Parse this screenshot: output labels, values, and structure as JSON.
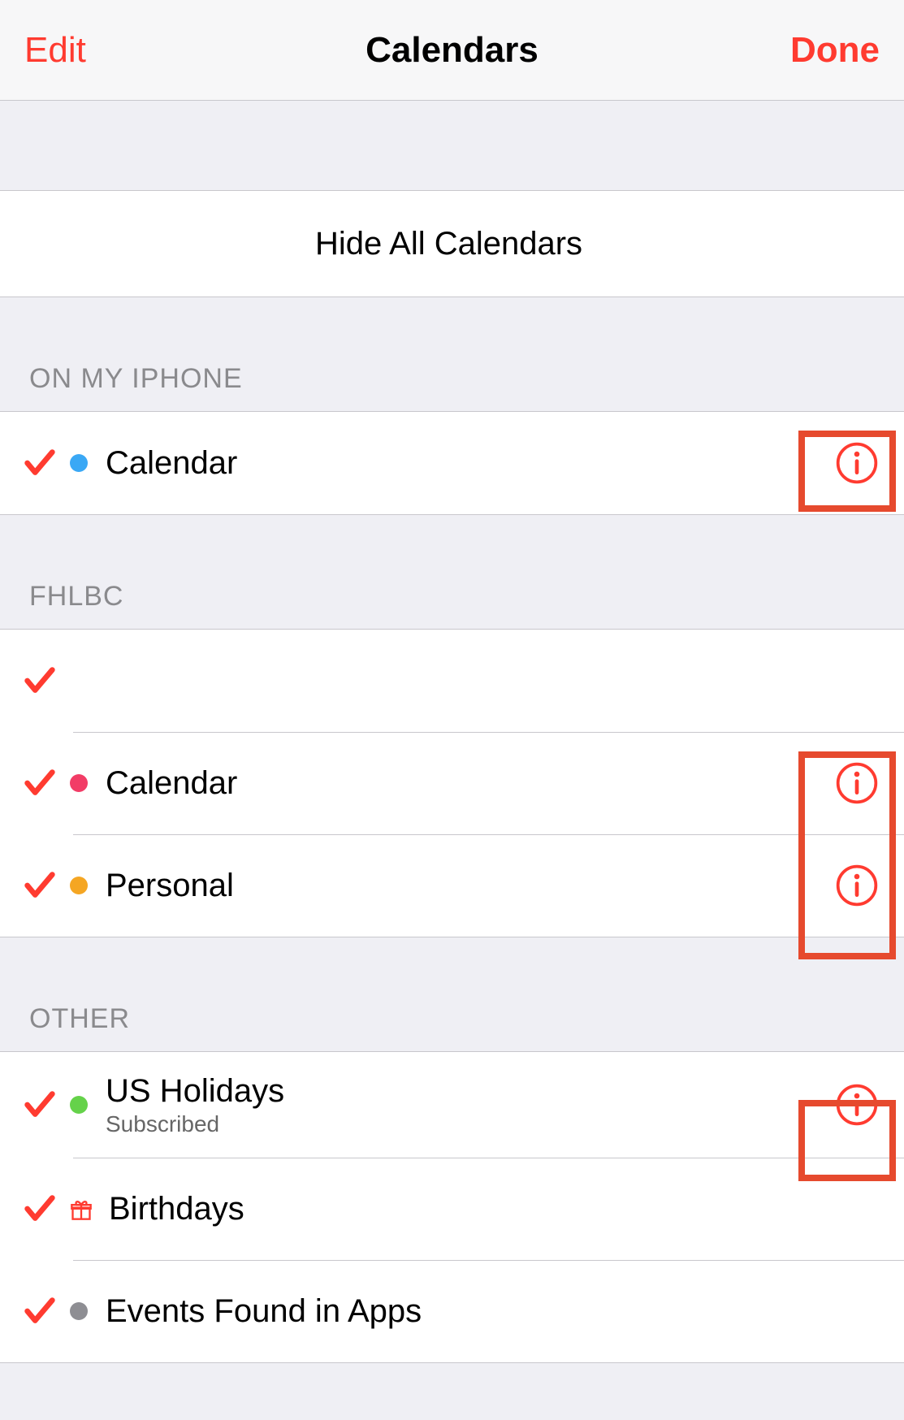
{
  "navbar": {
    "left": "Edit",
    "title": "Calendars",
    "right": "Done"
  },
  "hide_all_label": "Hide All Calendars",
  "colors": {
    "accent": "#ff3b30",
    "gray_text": "#8a8a8d",
    "blue_dot": "#3aa8f5",
    "pink_dot": "#f23c66",
    "orange_dot": "#f5a623",
    "green_dot": "#65d24a",
    "gray_dot": "#8e8e93"
  },
  "sections": [
    {
      "header": "ON MY IPHONE",
      "items": [
        {
          "label": "Calendar",
          "dot_color": "blue_dot",
          "checked": true,
          "info": true
        }
      ]
    },
    {
      "header": "FHLBC",
      "items": [
        {
          "label": "",
          "dot_color": null,
          "checked": true,
          "info": false
        },
        {
          "label": "Calendar",
          "dot_color": "pink_dot",
          "checked": true,
          "info": true
        },
        {
          "label": "Personal",
          "dot_color": "orange_dot",
          "checked": true,
          "info": true
        }
      ]
    },
    {
      "header": "OTHER",
      "items": [
        {
          "label": "US Holidays",
          "subtitle": "Subscribed",
          "dot_color": "green_dot",
          "checked": true,
          "info": true
        },
        {
          "label": "Birthdays",
          "icon": "gift",
          "checked": true,
          "info": false
        },
        {
          "label": "Events Found in Apps",
          "dot_color": "gray_dot",
          "checked": true,
          "info": false
        }
      ]
    }
  ]
}
